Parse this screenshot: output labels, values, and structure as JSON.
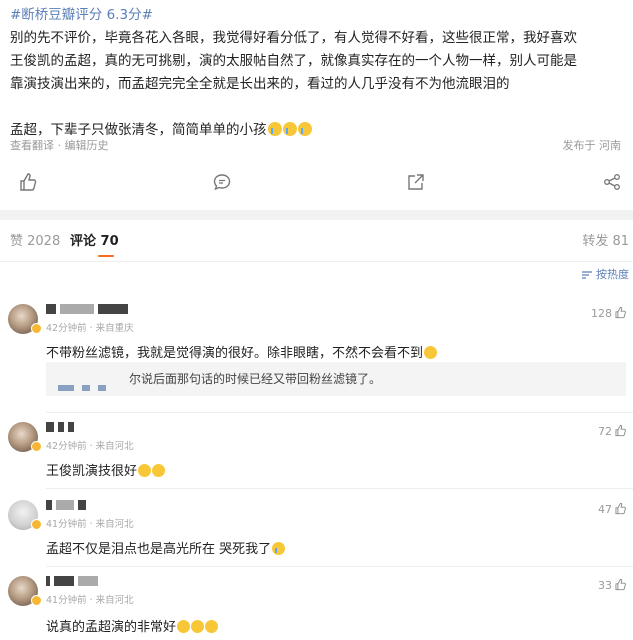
{
  "post": {
    "hashtag": "#断桥豆瓣评分 6.3分#",
    "line1": "别的先不评价，毕竟各花入各眼，我觉得好看分低了，有人觉得不好看，这些很正常，我好喜欢",
    "line2": "王俊凯的孟超，真的无可挑剔，演的太服帖自然了，就像真实存在的一个人物一样，别人可能是",
    "line3": "靠演技演出来的，而孟超完完全全就是长出来的，看过的人几乎没有不为他流眼泪的",
    "line4": "孟超，下辈子只做张清冬，简简单单的小孩",
    "line4_emoji": [
      "cry",
      "cry",
      "cry"
    ],
    "meta_left": "查看翻译 · 编辑历史",
    "meta_right": "发布于 河南",
    "actions": [
      "like-icon",
      "comment-icon",
      "share-icon",
      "forward-icon"
    ]
  },
  "tabs": {
    "likes": "赞 2028",
    "comments": "评论 70",
    "reposts": "转发 81"
  },
  "sort_label": "按热度",
  "comments": [
    {
      "time": "42分钟前 · 来自重庆",
      "likes": "128",
      "text": "不带粉丝滤镜，我就是觉得演的很好。除非眼瞎，不然不会看不到",
      "reply": "尔说后面那句话的时候已经又带回粉丝滤镜了。"
    },
    {
      "time": "42分钟前 · 来自河北",
      "likes": "72",
      "text": "王俊凯演技很好"
    },
    {
      "time": "41分钟前 · 来自河北",
      "likes": "47",
      "text": "孟超不仅是泪点也是高光所在 哭死我了"
    },
    {
      "time": "41分钟前 · 来自河北",
      "likes": "33",
      "text": "说真的孟超演的非常好"
    }
  ],
  "colors": {
    "link": "#5b7fb8",
    "accent": "#f26c22",
    "meta": "#9a9a9a",
    "divider": "#f2f2f2"
  }
}
